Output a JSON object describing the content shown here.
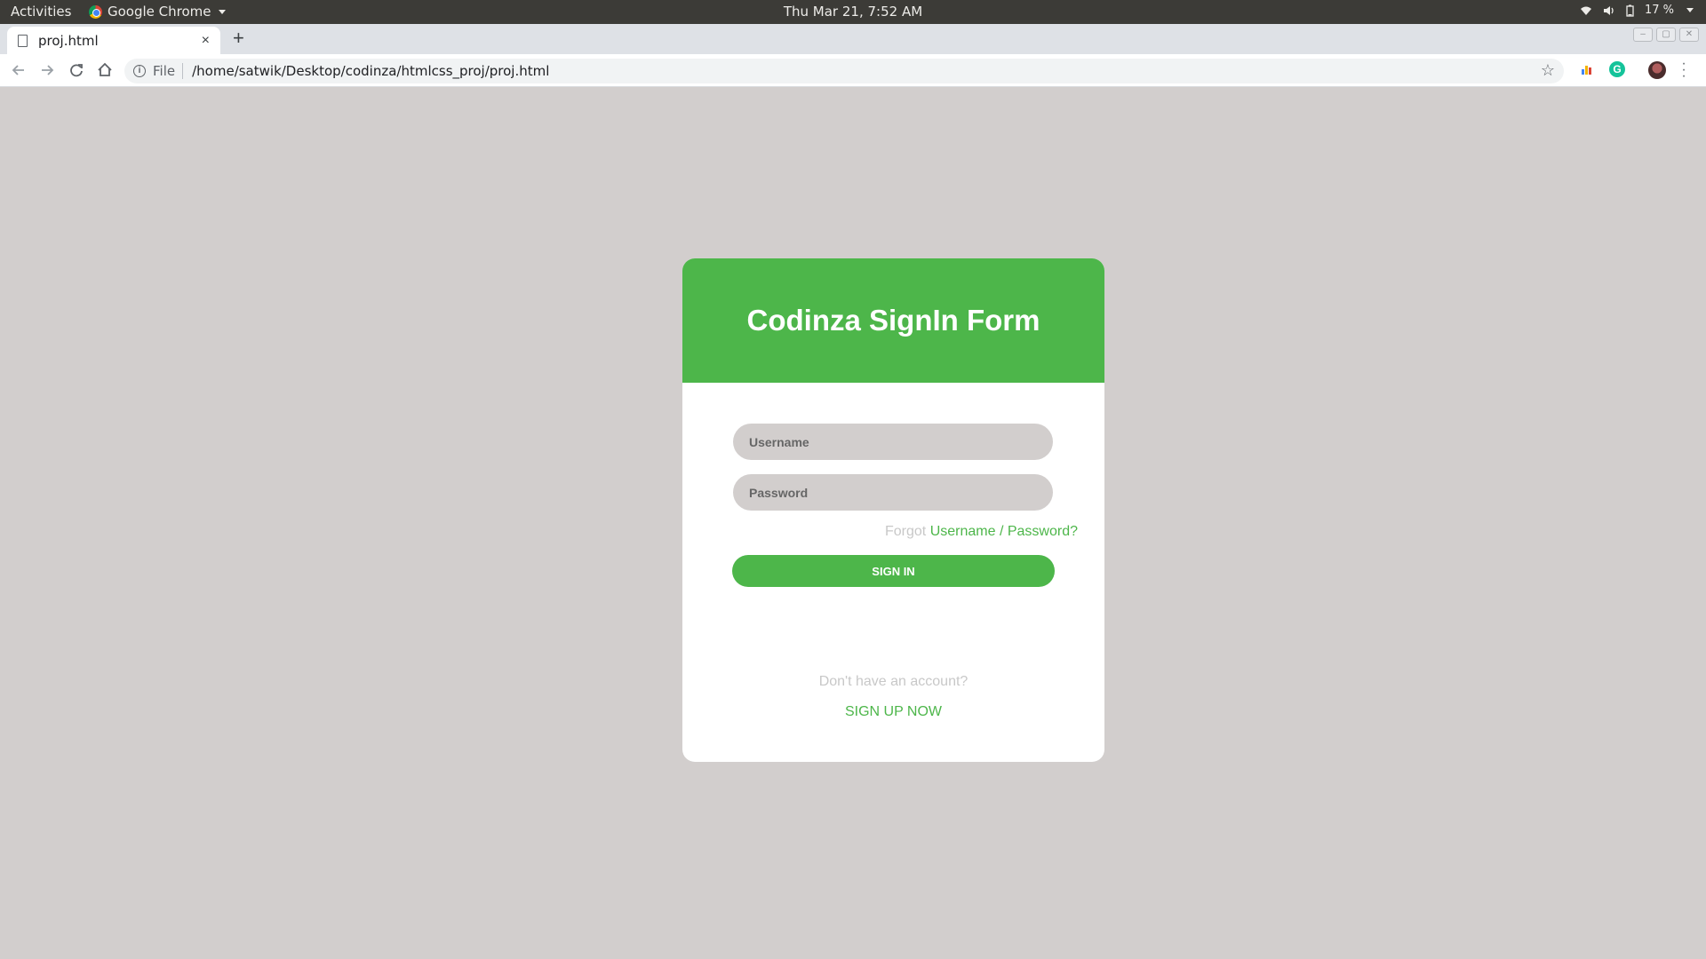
{
  "system_bar": {
    "activities": "Activities",
    "app_name": "Google Chrome",
    "clock": "Thu Mar 21,  7:52 AM",
    "battery": "17 %"
  },
  "browser": {
    "tab_title": "proj.html",
    "tab_close": "×",
    "new_tab": "+",
    "scheme_label": "File",
    "url": "/home/satwik/Desktop/codinza/htmlcss_proj/proj.html"
  },
  "form": {
    "title": "Codinza SignIn Form",
    "username_placeholder": "Username",
    "password_placeholder": "Password",
    "forgot_prefix": "Forgot",
    "forgot_link": "Username / Password?",
    "signin_label": "SIGN IN",
    "no_account_text": "Don't have an account?",
    "signup_label": "SIGN UP NOW"
  },
  "colors": {
    "accent": "#4db64a",
    "page_background": "#d2cecd",
    "muted_text": "#c8c8c8"
  },
  "icons": [
    "chrome-logo-icon",
    "wifi-icon",
    "volume-icon",
    "battery-icon",
    "page-icon",
    "back-icon",
    "forward-icon",
    "reload-icon",
    "home-icon",
    "info-icon",
    "star-icon",
    "grammarly-icon",
    "avatar",
    "menu-icon"
  ]
}
